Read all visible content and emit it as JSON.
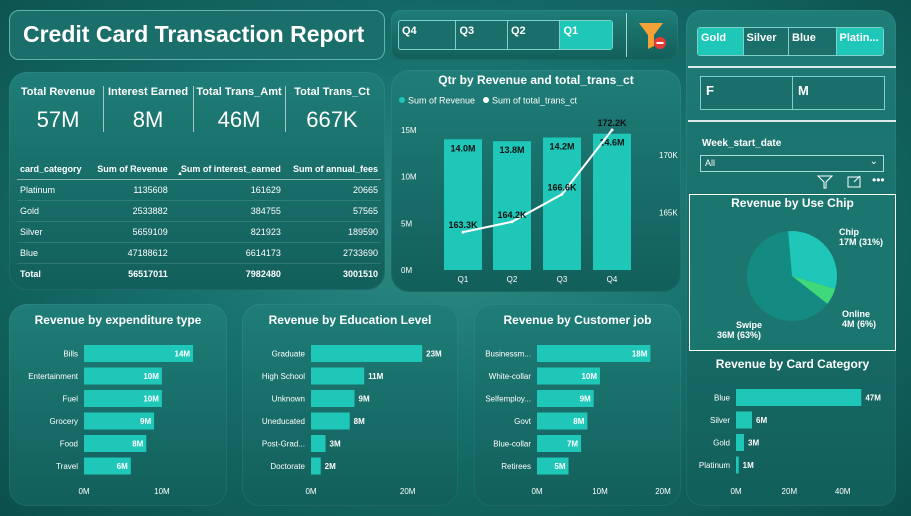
{
  "report_title": "Credit Card Transaction Report",
  "quarter_slicer": [
    "Q4",
    "Q3",
    "Q2",
    "Q1"
  ],
  "quarter_selected": [
    false,
    false,
    false,
    true
  ],
  "card_slicer": [
    "Gold",
    "Silver",
    "Blue",
    "Platin..."
  ],
  "card_selected": [
    true,
    false,
    false,
    true
  ],
  "gender_slicer": [
    "F",
    "M"
  ],
  "week_filter": {
    "label": "Week_start_date",
    "value": "All"
  },
  "kpis": [
    {
      "label": "Total Revenue",
      "value": "57M"
    },
    {
      "label": "Interest Earned",
      "value": "8M"
    },
    {
      "label": "Total Trans_Amt",
      "value": "46M"
    },
    {
      "label": "Total Trans_Ct",
      "value": "667K"
    }
  ],
  "table": {
    "headers": [
      "card_category",
      "Sum of Revenue",
      "Sum of interest_earned",
      "Sum of annual_fees"
    ],
    "rows": [
      [
        "Platinum",
        "1135608",
        "161629",
        "20665"
      ],
      [
        "Gold",
        "2533882",
        "384755",
        "57565"
      ],
      [
        "Silver",
        "5659109",
        "821923",
        "189590"
      ],
      [
        "Blue",
        "47188612",
        "6614173",
        "2733690"
      ]
    ],
    "total": [
      "Total",
      "56517011",
      "7982480",
      "3001510"
    ]
  },
  "colors": {
    "accent": "#1fc7b9",
    "panel": "#1a6f6a",
    "text": "#ffffff",
    "filter_red": "#e53935",
    "filter_orange": "#f4a236",
    "online_green": "#3fd97a"
  },
  "chart_data": [
    {
      "type": "bar",
      "title": "Qtr by Revenue and total_trans_ct",
      "categories": [
        "Q1",
        "Q2",
        "Q3",
        "Q4"
      ],
      "series": [
        {
          "name": "Sum of Revenue",
          "values": [
            14.0,
            13.8,
            14.2,
            14.6
          ],
          "labels": [
            "14.0M",
            "13.8M",
            "14.2M",
            "14.6M"
          ]
        },
        {
          "name": "Sum of total_trans_ct",
          "values": [
            163.3,
            164.2,
            166.6,
            172.2
          ],
          "labels": [
            "163.3K",
            "164.2K",
            "166.6K",
            "172.2K"
          ]
        }
      ],
      "y_ticks": [
        "0M",
        "5M",
        "10M",
        "15M"
      ],
      "y2_ticks": [
        "165K",
        "170K"
      ],
      "ylim": [
        0,
        15
      ],
      "y2lim": [
        160,
        172.2
      ]
    },
    {
      "type": "bar",
      "title": "Revenue by expenditure type",
      "categories": [
        "Bills",
        "Entertainment",
        "Fuel",
        "Grocery",
        "Food",
        "Travel"
      ],
      "values": [
        14,
        10,
        10,
        9,
        8,
        6
      ],
      "labels": [
        "14M",
        "10M",
        "10M",
        "9M",
        "8M",
        "6M"
      ],
      "x_ticks": [
        "0M",
        "10M"
      ],
      "xlim": [
        0,
        14.5
      ]
    },
    {
      "type": "bar",
      "title": "Revenue by Education Level",
      "categories": [
        "Graduate",
        "High School",
        "Unknown",
        "Uneducated",
        "Post-Grad...",
        "Doctorate"
      ],
      "values": [
        23,
        11,
        9,
        8,
        3,
        2
      ],
      "labels": [
        "23M",
        "11M",
        "9M",
        "8M",
        "3M",
        "2M"
      ],
      "x_ticks": [
        "0M",
        "20M"
      ],
      "xlim": [
        0,
        24
      ]
    },
    {
      "type": "bar",
      "title": "Revenue by Customer job",
      "categories": [
        "Businessm...",
        "White-collar",
        "Selfemploy...",
        "Govt",
        "Blue-collar",
        "Retirees"
      ],
      "values": [
        18,
        10,
        9,
        8,
        7,
        5
      ],
      "labels": [
        "18M",
        "10M",
        "9M",
        "8M",
        "7M",
        "5M"
      ],
      "x_ticks": [
        "0M",
        "10M",
        "20M"
      ],
      "xlim": [
        0,
        20
      ]
    },
    {
      "type": "pie",
      "title": "Revenue by Use Chip",
      "categories": [
        "Swipe",
        "Chip",
        "Online"
      ],
      "values": [
        63,
        31,
        6
      ],
      "labels": [
        "36M (63%)",
        "17M (31%)",
        "4M (6%)"
      ]
    },
    {
      "type": "bar",
      "title": "Revenue by Card Category",
      "categories": [
        "Blue",
        "Silver",
        "Gold",
        "Platinum"
      ],
      "values": [
        47,
        6,
        3,
        1
      ],
      "labels": [
        "47M",
        "6M",
        "3M",
        "1M"
      ],
      "x_ticks": [
        "0M",
        "20M",
        "40M"
      ],
      "xlim": [
        0,
        48
      ]
    }
  ]
}
